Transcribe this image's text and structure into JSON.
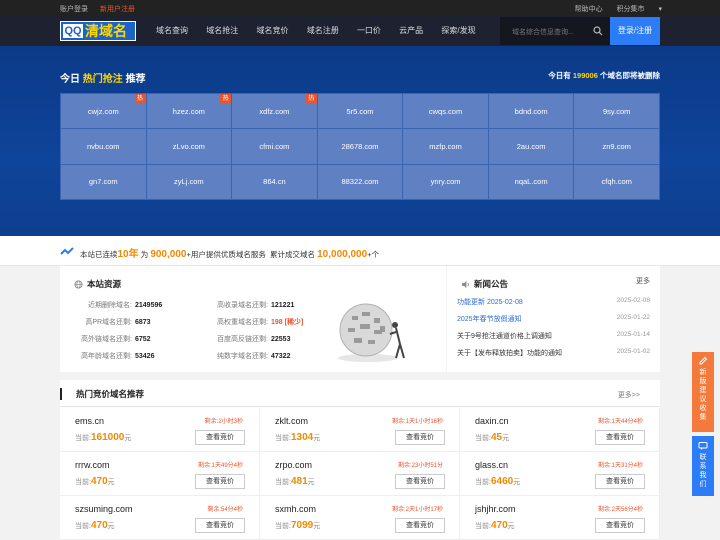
{
  "topbar": {
    "login": "账户登录",
    "register": "新用户注册",
    "help": "帮助中心",
    "points": "积分集市"
  },
  "logo": {
    "text1": "QQ",
    "text2": "清域名"
  },
  "nav": {
    "items": [
      "域名查询",
      "域名抢注",
      "域名竞价",
      "域名注册",
      "一口价",
      "云产品",
      "探索/发现"
    ],
    "search_placeholder": "域名综合信息查询...",
    "login_button": "登录/注册"
  },
  "banner": {
    "title_prefix": "今日",
    "title_highlight": "热门抢注",
    "title_suffix": "推荐",
    "right_prefix": "今日有",
    "right_count": "199006",
    "right_suffix": "个域名即将被删除",
    "hot_badge": "热",
    "domains": [
      {
        "name": "cwjz.com",
        "hot": true
      },
      {
        "name": "hzez.com",
        "hot": true
      },
      {
        "name": "xdfz.com",
        "hot": true
      },
      {
        "name": "5r5.com",
        "hot": false
      },
      {
        "name": "cwqs.com",
        "hot": false
      },
      {
        "name": "bdnd.com",
        "hot": false
      },
      {
        "name": "9sy.com",
        "hot": false
      },
      {
        "name": "nvbu.com",
        "hot": false
      },
      {
        "name": "zLvo.com",
        "hot": false
      },
      {
        "name": "cfmi.com",
        "hot": false
      },
      {
        "name": "28678.com",
        "hot": false
      },
      {
        "name": "mzfp.com",
        "hot": false
      },
      {
        "name": "2au.com",
        "hot": false
      },
      {
        "name": "zn9.com",
        "hot": false
      },
      {
        "name": "gn7.com",
        "hot": false
      },
      {
        "name": "zyLj.com",
        "hot": false
      },
      {
        "name": "864.cn",
        "hot": false
      },
      {
        "name": "88322.com",
        "hot": false
      },
      {
        "name": "ynry.com",
        "hot": false
      },
      {
        "name": "nqaL.com",
        "hot": false
      },
      {
        "name": "cfqh.com",
        "hot": false
      }
    ]
  },
  "stats": {
    "t1": "本站已连续",
    "years": "10年",
    "t2": "为",
    "users": "900,000",
    "t3": "+用户提供优质域名服务",
    "t4": "累计成交域名",
    "deals": "10,000,000",
    "t5": "+个"
  },
  "resources": {
    "title": "本站资源",
    "rows": [
      {
        "label": "近期删除域名:",
        "value": "2149596"
      },
      {
        "label": "高收录域名还剩:",
        "value": "121221"
      },
      {
        "label": "高PR域名还剩:",
        "value": "6873"
      },
      {
        "label": "高权重域名还剩:",
        "value": "198 [稀少]"
      },
      {
        "label": "高外链域名还剩:",
        "value": "6752"
      },
      {
        "label": "百度高反链还剩:",
        "value": "22553"
      },
      {
        "label": "高年龄域名还剩:",
        "value": "53426"
      },
      {
        "label": "纯数字域名还剩:",
        "value": "47322"
      }
    ]
  },
  "news": {
    "title": "新闻公告",
    "more": "更多",
    "items": [
      {
        "title": "功能更新 2025-02-08",
        "date": "2025-02-08"
      },
      {
        "title": "2025年春节放假通知",
        "date": "2025-01-22"
      },
      {
        "title": "关于9号抢注通道价格上调通知",
        "date": "2025-01-14"
      },
      {
        "title": "关于【发布释放拍卖】功能的通知",
        "date": "2025-01-02"
      }
    ]
  },
  "auction": {
    "title": "热门竞价域名推荐",
    "more": "更多>>",
    "current_label": "当前:",
    "currency": "元",
    "button": "查看竞价",
    "items": [
      {
        "domain": "ems.cn",
        "remain": "剩余:2小时3秒",
        "price": "161000"
      },
      {
        "domain": "zklt.com",
        "remain": "剩余:1天1小时16秒",
        "price": "1304"
      },
      {
        "domain": "daxin.cn",
        "remain": "剩余:1天44分4秒",
        "price": "45"
      },
      {
        "domain": "rrrw.com",
        "remain": "剩余:1天49分4秒",
        "price": "470"
      },
      {
        "domain": "zrpo.com",
        "remain": "剩余:23小时51分",
        "price": "481"
      },
      {
        "domain": "glass.cn",
        "remain": "剩余:1天31分4秒",
        "price": "6460"
      },
      {
        "domain": "szsuming.com",
        "remain": "剩余:54分4秒",
        "price": "470"
      },
      {
        "domain": "sxmh.com",
        "remain": "剩余:2天1小时17秒",
        "price": "7099"
      },
      {
        "domain": "jshjhr.com",
        "remain": "剩余:2天56分4秒",
        "price": "470"
      }
    ]
  },
  "side": {
    "feedback": "新版建议收集",
    "contact": "联系我们"
  }
}
